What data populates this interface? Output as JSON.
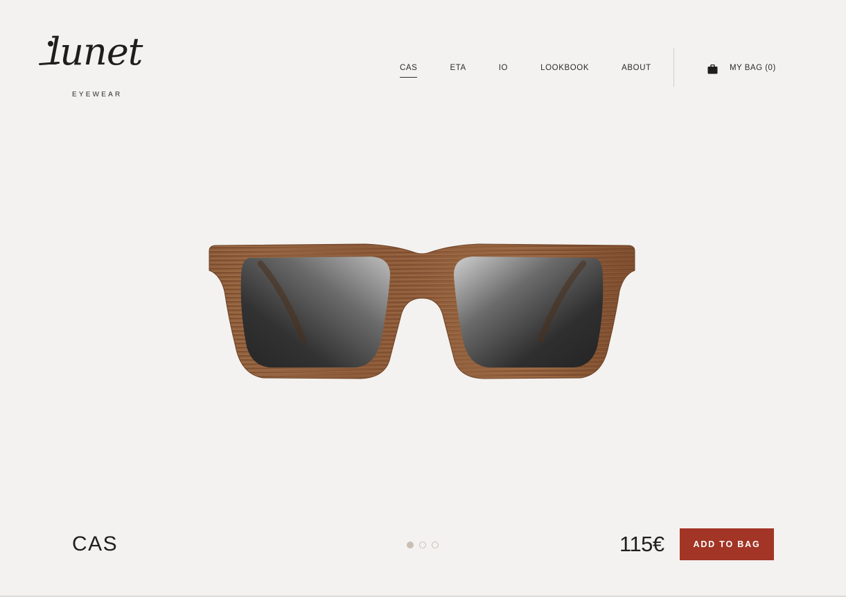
{
  "brand": {
    "logo_script": "lunet",
    "logo_sub": "EYEWEAR"
  },
  "nav": {
    "items": [
      {
        "label": "CAS",
        "active": true
      },
      {
        "label": "ETA",
        "active": false
      },
      {
        "label": "IO",
        "active": false
      },
      {
        "label": "LOOKBOOK",
        "active": false
      },
      {
        "label": "ABOUT",
        "active": false
      }
    ],
    "bag_label": "MY BAG (0)",
    "bag_icon": "shopping-bag-icon"
  },
  "product": {
    "name": "CAS",
    "price": "115€",
    "add_label": "ADD TO BAG",
    "image_description_icon": "wooden-sunglasses",
    "gallery": {
      "count": 3,
      "active_index": 0
    }
  },
  "colors": {
    "background": "#f3f2f0",
    "accent": "#a23526",
    "text": "#1f1f1f",
    "wood": "#8a5836",
    "lens": "#2e2e2e",
    "dot": "#c9bfb4"
  }
}
